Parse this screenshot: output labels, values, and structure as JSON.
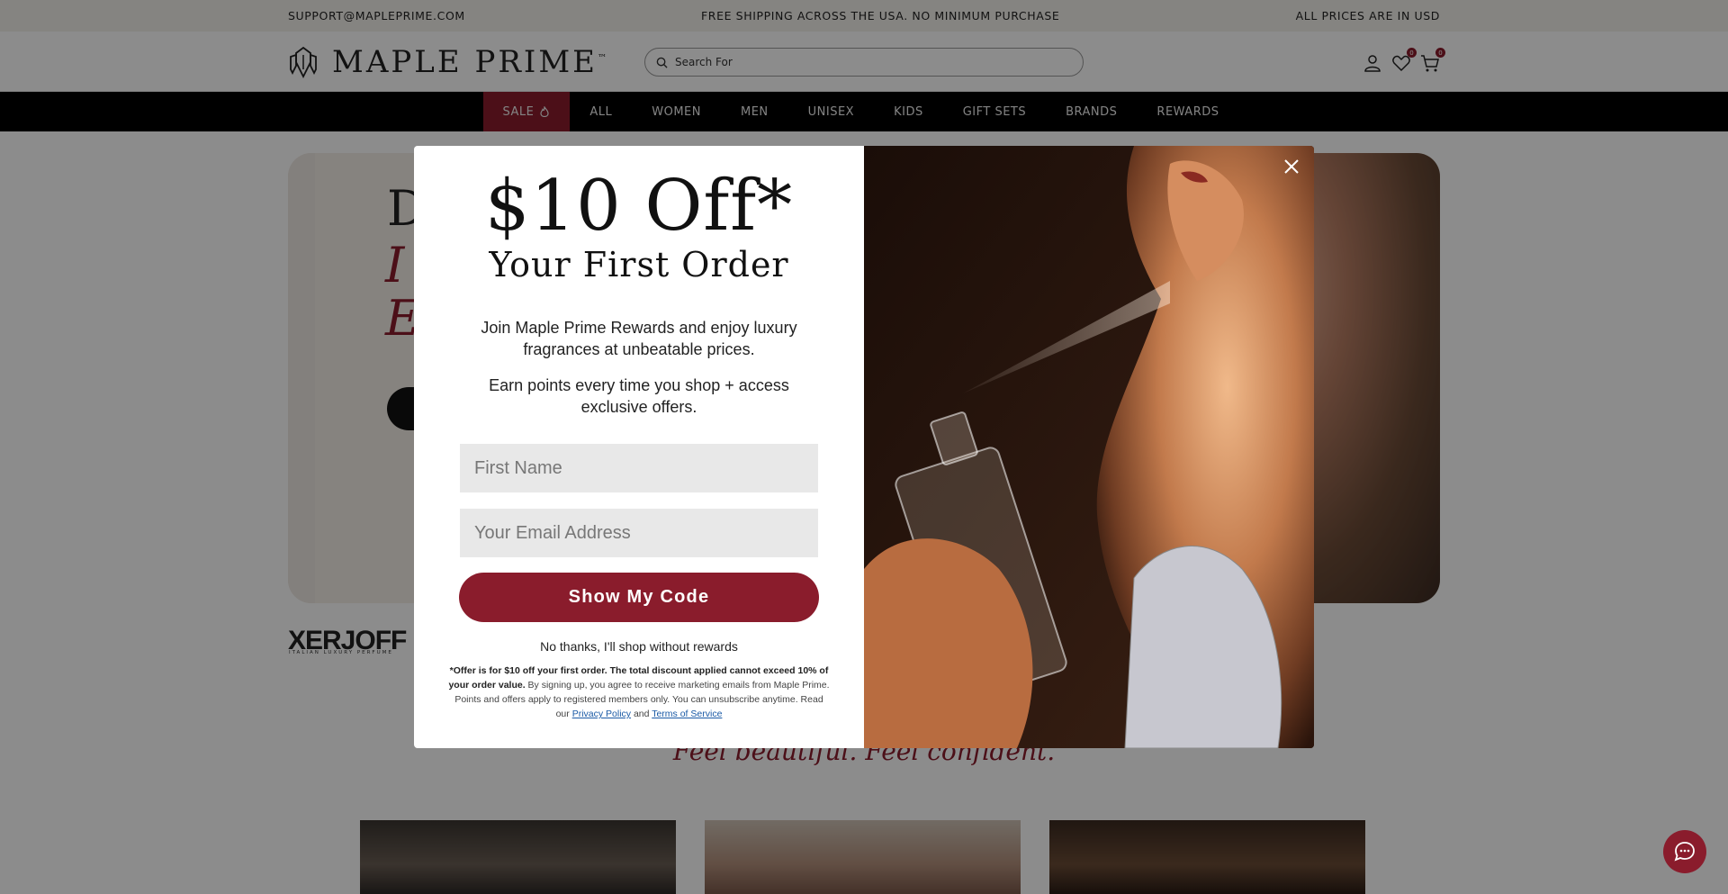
{
  "topbar": {
    "email": "SUPPORT@MAPLEPRIME.COM",
    "shipping": "FREE SHIPPING ACROSS THE USA. NO MINIMUM PURCHASE",
    "currency": "ALL PRICES ARE IN USD"
  },
  "header": {
    "logo_text": "MAPLE PRIME",
    "logo_tm": "™",
    "search_placeholder": "Search For",
    "wishlist_count": "0",
    "cart_count": "0"
  },
  "nav": {
    "items": [
      "SALE",
      "ALL",
      "WOMEN",
      "MEN",
      "UNISEX",
      "KIDS",
      "GIFT SETS",
      "BRANDS",
      "REWARDS"
    ]
  },
  "page": {
    "brand_logo": "XERJOFF",
    "brand_logo_sub": "ITALIAN LUXURY PERFUME",
    "tagline": "Feel beautiful. Feel confident."
  },
  "modal": {
    "headline": "$10 Off*",
    "subheadline": "Your First Order",
    "para1": "Join Maple Prime Rewards and enjoy luxury fragrances at unbeatable prices.",
    "para2": "Earn points every time you shop + access exclusive offers.",
    "first_name_placeholder": "First Name",
    "email_placeholder": "Your Email Address",
    "cta_label": "Show My Code",
    "no_thanks": "No thanks, I'll shop without rewards",
    "fine_bold": "*Offer is for $10 off your first order. The total discount applied cannot exceed 10% of your order value.",
    "fine_text": " By signing up, you agree to receive marketing emails from Maple Prime. Points and offers apply to registered members only. You can unsubscribe anytime. Read our ",
    "privacy_link": "Privacy Policy",
    "and_text": " and ",
    "terms_link": "Terms of Service"
  },
  "colors": {
    "brand": "#8a1c2c",
    "nav_bg": "#000000",
    "topbar_bg": "#f3f1ec"
  }
}
